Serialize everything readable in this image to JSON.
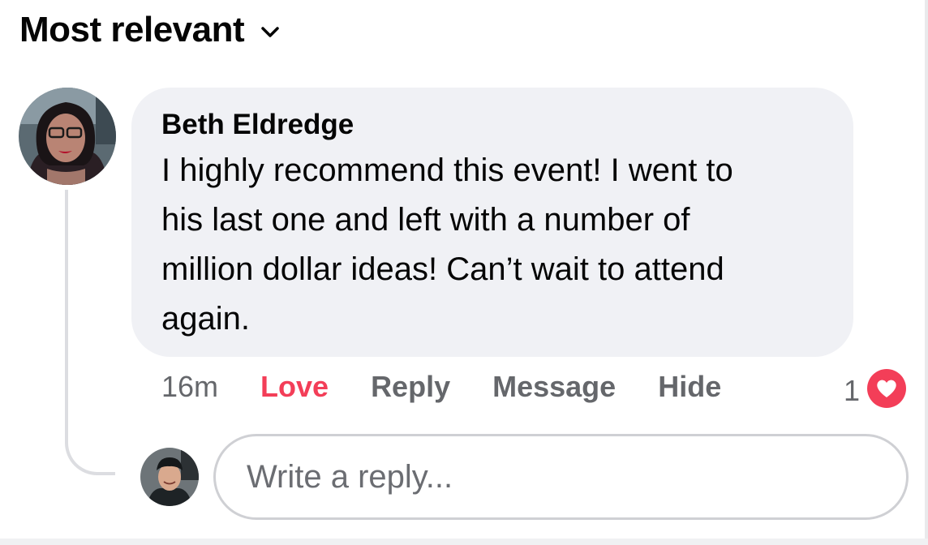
{
  "sort": {
    "label": "Most relevant",
    "icon": "chevron-down-icon"
  },
  "comment": {
    "author": "Beth Eldredge",
    "lines": [
      "I highly recommend this event! I went to",
      "his last one and left with a number of",
      "million dollar ideas! Can’t wait to attend",
      "again."
    ],
    "timestamp": "16m",
    "actions": {
      "love": "Love",
      "reply": "Reply",
      "message": "Message",
      "hide": "Hide"
    },
    "reaction": {
      "count": "1",
      "icon": "heart-reaction-icon",
      "color": "#f33e58"
    }
  },
  "reply": {
    "placeholder": "Write a reply..."
  },
  "colors": {
    "love_active": "#f33e58",
    "bubble": "#f0f1f5",
    "muted": "#65676b"
  }
}
